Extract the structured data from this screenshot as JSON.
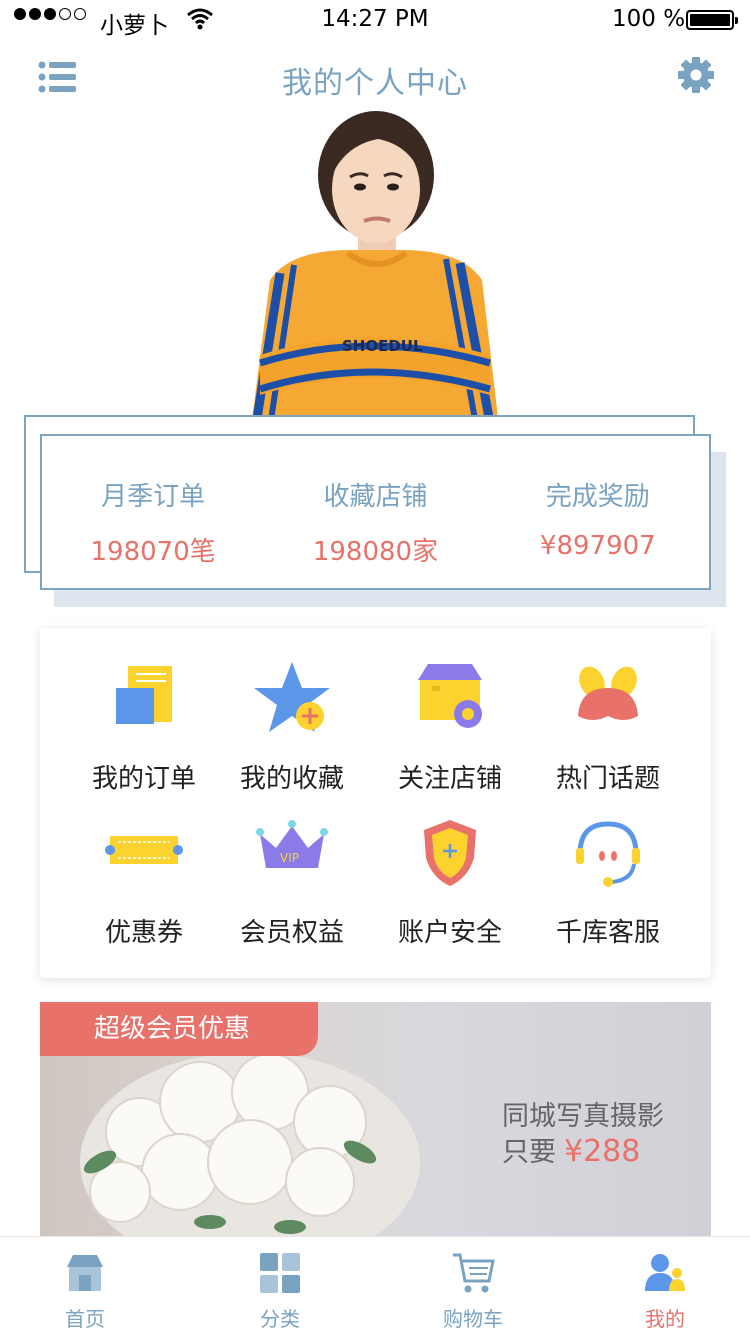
{
  "status_bar": {
    "carrier": "小萝卜",
    "time": "14:27 PM",
    "battery": "100 %"
  },
  "header": {
    "title": "我的个人中心",
    "menu_icon": "list-icon",
    "settings_icon": "gear-icon"
  },
  "stats": [
    {
      "label": "月季订单",
      "value": "198070笔"
    },
    {
      "label": "收藏店铺",
      "value": "198080家"
    },
    {
      "label": "完成奖励",
      "value": "¥897907"
    }
  ],
  "services": [
    {
      "label": "我的订单",
      "icon": "order-icon"
    },
    {
      "label": "我的收藏",
      "icon": "favorite-star-icon"
    },
    {
      "label": "关注店铺",
      "icon": "shop-box-icon"
    },
    {
      "label": "热门话题",
      "icon": "hot-topic-icon"
    },
    {
      "label": "优惠券",
      "icon": "coupon-icon"
    },
    {
      "label": "会员权益",
      "icon": "vip-crown-icon",
      "badge": "VIP"
    },
    {
      "label": "账户安全",
      "icon": "shield-icon"
    },
    {
      "label": "千库客服",
      "icon": "headset-icon"
    }
  ],
  "banner": {
    "ribbon": "超级会员优惠",
    "line1": "同城写真摄影",
    "line2_prefix": "只要",
    "price": "¥288"
  },
  "tabbar": [
    {
      "label": "首页",
      "icon": "home-shop-icon"
    },
    {
      "label": "分类",
      "icon": "category-grid-icon"
    },
    {
      "label": "购物车",
      "icon": "cart-icon"
    },
    {
      "label": "我的",
      "icon": "user-icon",
      "active": true
    }
  ],
  "colors": {
    "accent_blue": "#7aa3c1",
    "accent_red": "#e8716a",
    "yellow": "#fcd22f",
    "purple": "#8b7be8"
  }
}
